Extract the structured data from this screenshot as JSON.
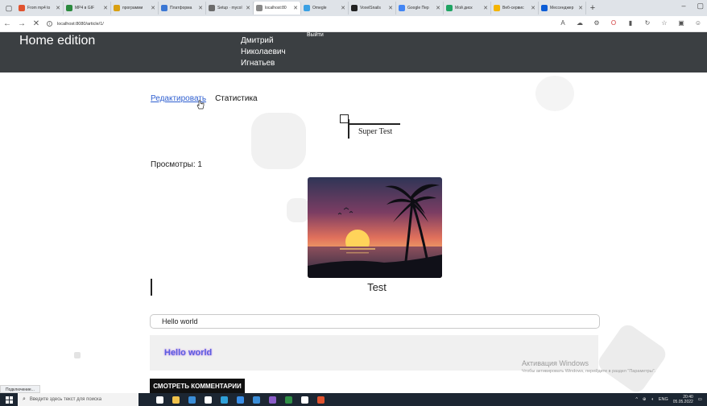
{
  "browser": {
    "tabs": [
      {
        "title": "From mp4 to",
        "color": "#e0522e"
      },
      {
        "title": "MP4 в GIF",
        "color": "#2b8a3e"
      },
      {
        "title": "программи",
        "color": "#d9a011"
      },
      {
        "title": "Платформа",
        "color": "#3b77d4"
      },
      {
        "title": "Setup · mycol",
        "color": "#6b6b6b"
      },
      {
        "title": "localhost:80",
        "color": "#888888",
        "active": true
      },
      {
        "title": "Omegle",
        "color": "#3aa0e3"
      },
      {
        "title": "VoxelSnails",
        "color": "#222222"
      },
      {
        "title": "Google Пер",
        "color": "#4285f4"
      },
      {
        "title": "Мой диск",
        "color": "#1fa463"
      },
      {
        "title": "Веб-сервис",
        "color": "#f4b400"
      },
      {
        "title": "Мессенджер",
        "color": "#0b5cd6"
      }
    ],
    "new_tab": "+",
    "window_controls": [
      "–",
      "▢"
    ],
    "url": "localhost:8080/article/1/"
  },
  "site": {
    "brand": "Home edition",
    "user_name": "Дмитрий Николаевич Игнатьев",
    "logout": "Выйти"
  },
  "article": {
    "edit_link": "Редактировать",
    "stats_link": "Статистика",
    "logo_text": "Super Test",
    "views": "Просмотры: 1",
    "image_caption": "Test"
  },
  "comment": {
    "input_value": "Hello world",
    "preview_text": "Hello world",
    "show_button": "СМОТРЕТЬ КОММЕНТАРИИ"
  },
  "overlay": {
    "activation_title": "Активация Windows",
    "activation_text": "Чтобы активировать Windows, перейдите в раздел \"Параметры\"."
  },
  "statusbar": {
    "text": "Подключение..."
  },
  "taskbar": {
    "search_placeholder": "Введите здесь текст для поиска",
    "apps": [
      {
        "name": "task-view",
        "color": "#ffffff"
      },
      {
        "name": "explorer",
        "color": "#f0c24b"
      },
      {
        "name": "mail",
        "color": "#3b8ed8"
      },
      {
        "name": "store",
        "color": "#ffffff"
      },
      {
        "name": "edge",
        "color": "#2fa0d8"
      },
      {
        "name": "vscode",
        "color": "#3a8ee6"
      },
      {
        "name": "check",
        "color": "#3b8ed8"
      },
      {
        "name": "vs",
        "color": "#8a5cc8"
      },
      {
        "name": "terminal",
        "color": "#2f8f46"
      },
      {
        "name": "monitor",
        "color": "#ffffff"
      },
      {
        "name": "chrome",
        "color": "#e0522e"
      }
    ],
    "language": "ENG",
    "time": "20:40",
    "date": "05.05.2022"
  }
}
